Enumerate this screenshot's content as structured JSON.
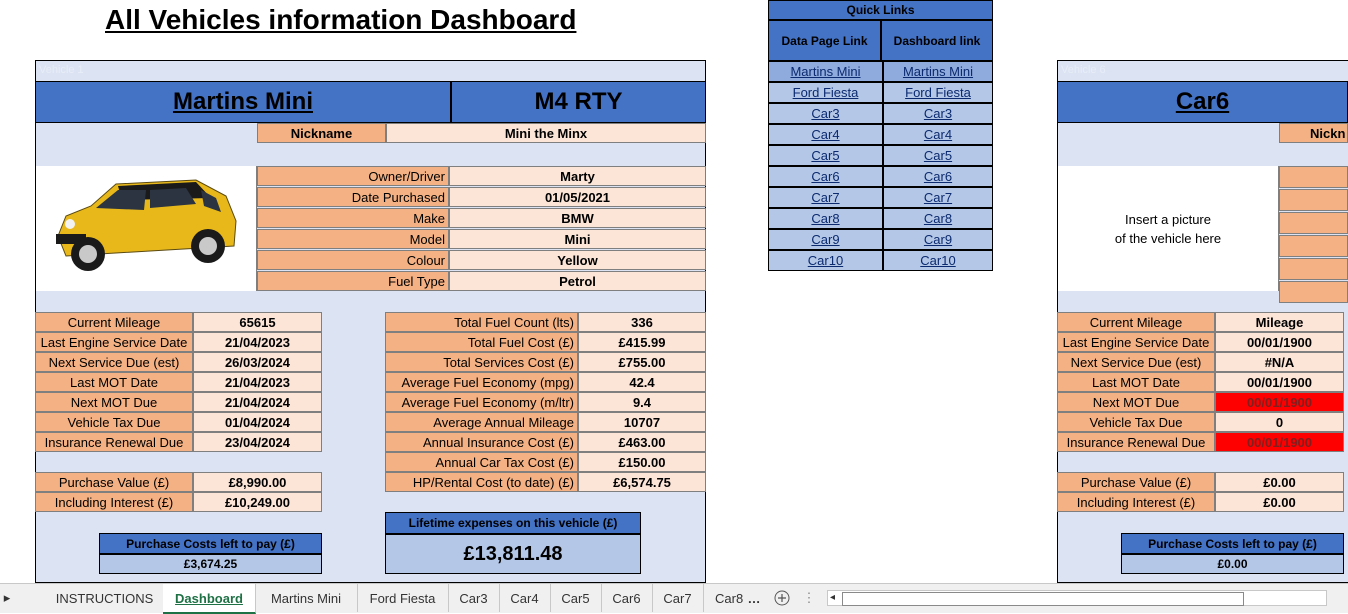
{
  "title": "All Vehicles information Dashboard",
  "quick_links": {
    "header": "Quick Links",
    "col1": "Data Page Link",
    "col2": "Dashboard link",
    "items": [
      "Martins Mini",
      "Ford Fiesta",
      "Car3",
      "Car4",
      "Car5",
      "Car6",
      "Car7",
      "Car8",
      "Car9",
      "Car10"
    ]
  },
  "vehicle1": {
    "label": "Vehicle 1",
    "name": "Martins Mini",
    "reg": "M4 RTY",
    "nickname_label": "Nickname",
    "nickname": "Mini the Minx",
    "details": [
      {
        "label": "Owner/Driver",
        "value": "Marty"
      },
      {
        "label": "Date Purchased",
        "value": "01/05/2021"
      },
      {
        "label": "Make",
        "value": "BMW"
      },
      {
        "label": "Model",
        "value": "Mini"
      },
      {
        "label": "Colour",
        "value": "Yellow"
      },
      {
        "label": "Fuel Type",
        "value": "Petrol"
      }
    ],
    "left_stats": [
      {
        "label": "Current Mileage",
        "value": "65615"
      },
      {
        "label": "Last Engine Service Date",
        "value": "21/04/2023"
      },
      {
        "label": "Next Service Due (est)",
        "value": "26/03/2024"
      },
      {
        "label": "Last MOT Date",
        "value": "21/04/2023"
      },
      {
        "label": "Next MOT Due",
        "value": "21/04/2024"
      },
      {
        "label": "Vehicle Tax Due",
        "value": "01/04/2024"
      },
      {
        "label": "Insurance Renewal Due",
        "value": "23/04/2024"
      }
    ],
    "purchase": [
      {
        "label": "Purchase Value (£)",
        "value": "£8,990.00"
      },
      {
        "label": "Including Interest (£)",
        "value": "£10,249.00"
      }
    ],
    "right_stats": [
      {
        "label": "Total Fuel Count (lts)",
        "value": "336"
      },
      {
        "label": "Total Fuel Cost (£)",
        "value": "£415.99"
      },
      {
        "label": "Total Services Cost (£)",
        "value": "£755.00"
      },
      {
        "label": "Average Fuel Economy (mpg)",
        "value": "42.4"
      },
      {
        "label": "Average Fuel Economy (m/ltr)",
        "value": "9.4"
      },
      {
        "label": "Average Annual Mileage",
        "value": "10707"
      },
      {
        "label": "Annual Insurance Cost (£)",
        "value": "£463.00"
      },
      {
        "label": "Annual Car Tax Cost (£)",
        "value": "£150.00"
      },
      {
        "label": "HP/Rental Cost (to date) (£)",
        "value": "£6,574.75"
      }
    ],
    "lifetime_label": "Lifetime expenses on this vehicle (£)",
    "lifetime_value": "£13,811.48",
    "left_to_pay_label": "Purchase Costs left to pay (£)",
    "left_to_pay_value": "£3,674.25"
  },
  "vehicle6": {
    "label": "Vehicle 6",
    "name": "Car6",
    "nickname_label": "Nickn",
    "picture_text_1": "Insert a picture",
    "picture_text_2": "of the vehicle here",
    "left_stats": [
      {
        "label": "Current Mileage",
        "value": "Mileage"
      },
      {
        "label": "Last Engine Service Date",
        "value": "00/01/1900"
      },
      {
        "label": "Next Service Due (est)",
        "value": "#N/A"
      },
      {
        "label": "Last MOT Date",
        "value": "00/01/1900"
      },
      {
        "label": "Next MOT Due",
        "value": "00/01/1900"
      },
      {
        "label": "Vehicle Tax Due",
        "value": "0"
      },
      {
        "label": "Insurance Renewal Due",
        "value": "00/01/1900"
      }
    ],
    "purchase": [
      {
        "label": "Purchase Value (£)",
        "value": "£0.00"
      },
      {
        "label": "Including Interest (£)",
        "value": "£0.00"
      }
    ],
    "left_to_pay_label": "Purchase Costs left to pay (£)",
    "left_to_pay_value": "£0.00"
  },
  "tabs": [
    "INSTRUCTIONS",
    "Dashboard",
    "Martins Mini",
    "Ford Fiesta",
    "Car3",
    "Car4",
    "Car5",
    "Car6",
    "Car7",
    "Car8"
  ],
  "active_tab": "Dashboard",
  "colors": {
    "blue": "#4472c4",
    "light_blue": "#b4c7e7",
    "orange": "#f4b183",
    "peach": "#fce4d6",
    "panel": "#dce3f2",
    "red": "#ff0000"
  }
}
